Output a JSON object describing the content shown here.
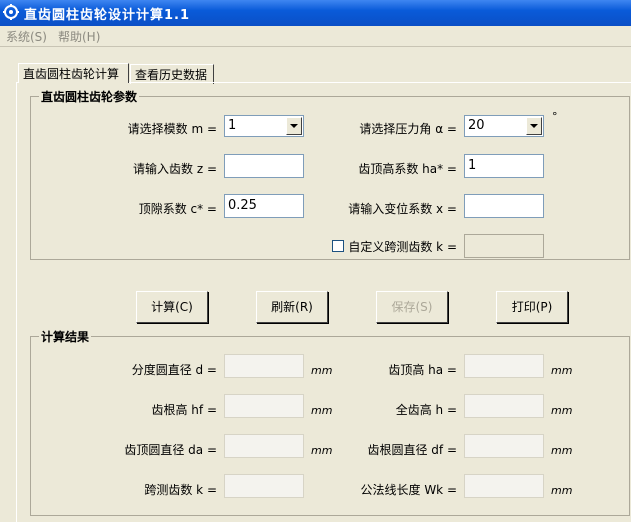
{
  "window": {
    "title": "直齿圆柱齿轮设计计算1.1"
  },
  "menu": [
    {
      "label": "系统(S)"
    },
    {
      "label": "帮助(H)"
    }
  ],
  "tabs": [
    {
      "label": "直齿圆柱齿轮计算",
      "active": true
    },
    {
      "label": "查看历史数据",
      "active": false
    }
  ],
  "params": {
    "caption": "直齿圆柱齿轮参数",
    "module_label": "请选择模数 m =",
    "module_value": "1",
    "pressure_angle_label": "请选择压力角 α =",
    "pressure_angle_value": "20",
    "degree_symbol": "°",
    "teeth_label": "请输入齿数 z =",
    "teeth_value": "",
    "addendum_coef_label": "齿顶高系数 ha* =",
    "addendum_coef_value": "1",
    "clearance_coef_label": "顶隙系数 c* =",
    "clearance_coef_value": "0.25",
    "shift_coef_label": "请输入变位系数 x =",
    "shift_coef_value": "",
    "custom_span_label": "自定义跨测齿数 k =",
    "custom_span_checked": false,
    "custom_span_value": ""
  },
  "buttons": {
    "calculate": "计算(C)",
    "refresh": "刷新(R)",
    "save": "保存(S)",
    "print": "打印(P)"
  },
  "results": {
    "caption": "计算结果",
    "unit": "mm",
    "pitch_diameter_label": "分度圆直径 d =",
    "pitch_diameter_value": "",
    "addendum_label": "齿顶高 ha =",
    "addendum_value": "",
    "dedendum_label": "齿根高 hf =",
    "dedendum_value": "",
    "whole_depth_label": "全齿高 h =",
    "whole_depth_value": "",
    "tip_diameter_label": "齿顶圆直径 da =",
    "tip_diameter_value": "",
    "root_diameter_label": "齿根圆直径 df =",
    "root_diameter_value": "",
    "span_teeth_label": "跨测齿数 k =",
    "span_teeth_value": "",
    "base_tangent_length_label": "公法线长度 Wk =",
    "base_tangent_length_value": ""
  },
  "colors": {
    "accent": "#0a5bd9",
    "group_caption": "#000000"
  }
}
